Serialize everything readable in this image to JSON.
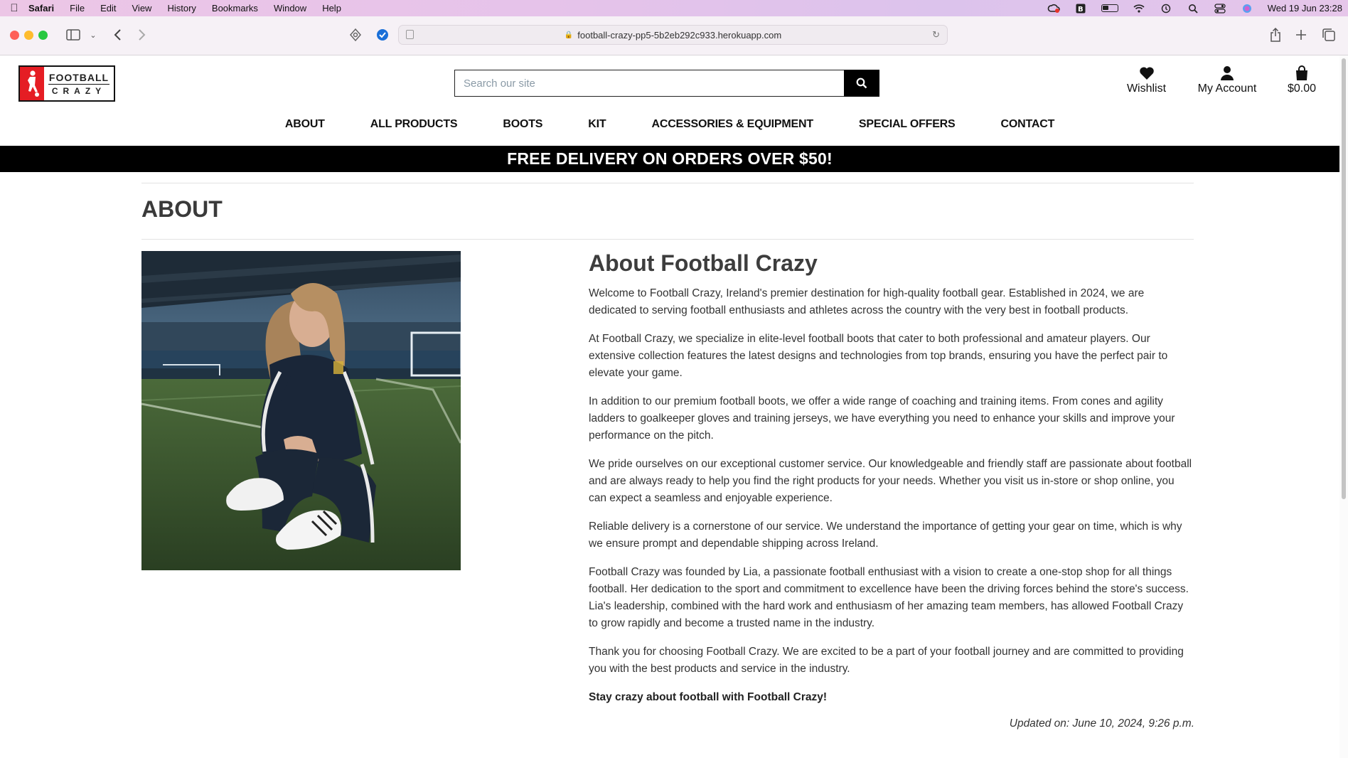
{
  "menubar": {
    "app": "Safari",
    "items": [
      "File",
      "Edit",
      "View",
      "History",
      "Bookmarks",
      "Window",
      "Help"
    ],
    "clock": "Wed 19 Jun  23:28"
  },
  "browser": {
    "url": "football-crazy-pp5-5b2eb292c933.herokuapp.com"
  },
  "site": {
    "logo": {
      "line1": "FOOTBALL",
      "line2": "CRAZY"
    },
    "search": {
      "placeholder": "Search our site"
    },
    "header_links": {
      "wishlist": "Wishlist",
      "account": "My Account",
      "bag_total": "$0.00"
    },
    "nav": [
      "ABOUT",
      "ALL PRODUCTS",
      "BOOTS",
      "KIT",
      "ACCESSORIES & EQUIPMENT",
      "SPECIAL OFFERS",
      "CONTACT"
    ],
    "banner": "FREE DELIVERY ON ORDERS OVER $50!"
  },
  "page": {
    "title": "ABOUT",
    "heading": "About Football Crazy",
    "paragraphs": [
      "Welcome to Football Crazy, Ireland's premier destination for high-quality football gear. Established in 2024, we are dedicated to serving football enthusiasts and athletes across the country with the very best in football products.",
      "At Football Crazy, we specialize in elite-level football boots that cater to both professional and amateur players. Our extensive collection features the latest designs and technologies from top brands, ensuring you have the perfect pair to elevate your game.",
      "In addition to our premium football boots, we offer a wide range of coaching and training items. From cones and agility ladders to goalkeeper gloves and training jerseys, we have everything you need to enhance your skills and improve your performance on the pitch.",
      "We pride ourselves on our exceptional customer service. Our knowledgeable and friendly staff are passionate about football and are always ready to help you find the right products for your needs. Whether you visit us in-store or shop online, you can expect a seamless and enjoyable experience.",
      "Reliable delivery is a cornerstone of our service. We understand the importance of getting your gear on time, which is why we ensure prompt and dependable shipping across Ireland.",
      "Football Crazy was founded by Lia, a passionate football enthusiast with a vision to create a one-stop shop for all things football. Her dedication to the sport and commitment to excellence have been the driving forces behind the store's success. Lia's leadership, combined with the hard work and enthusiasm of her amazing team members, has allowed Football Crazy to grow rapidly and become a trusted name in the industry.",
      "Thank you for choosing Football Crazy. We are excited to be a part of your football journey and are committed to providing you with the best products and service in the industry."
    ],
    "tagline": "Stay crazy about football with Football Crazy!",
    "updated": "Updated on: June 10, 2024, 9:26 p.m."
  },
  "colors": {
    "brand_red": "#e51d24",
    "banner_bg": "#000000",
    "banner_text": "#ffffff"
  }
}
